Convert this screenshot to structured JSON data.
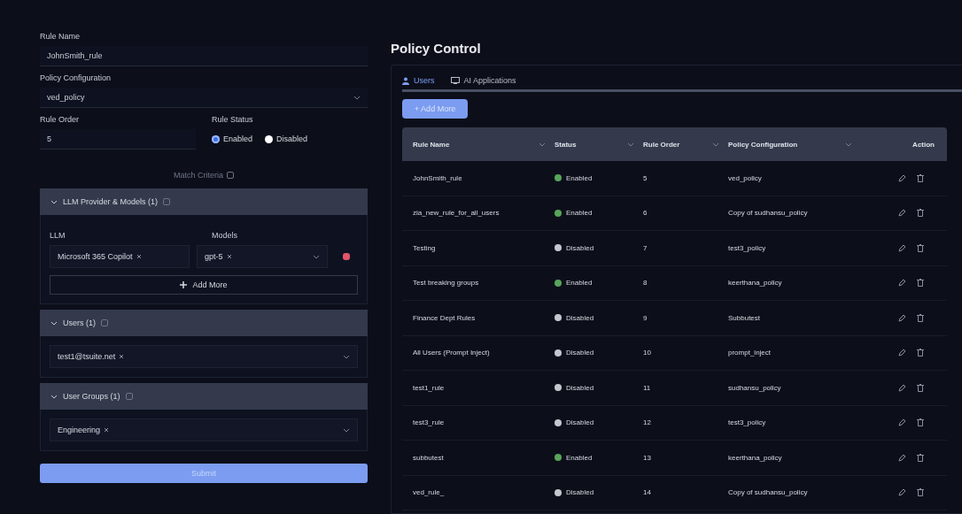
{
  "form": {
    "rule_name": {
      "label": "Rule Name",
      "value": "JohnSmith_rule"
    },
    "policy_configuration": {
      "label": "Policy Configuration",
      "value": "ved_policy"
    },
    "rule_order": {
      "label": "Rule Order",
      "value": "5"
    },
    "rule_status": {
      "label": "Rule Status",
      "options": [
        {
          "label": "Enabled",
          "selected": true
        },
        {
          "label": "Disabled",
          "selected": false
        }
      ]
    },
    "match_criteria": "Match Criteria",
    "sections": [
      {
        "kind": "llm",
        "title": "LLM Provider & Models (1)",
        "expanded": true,
        "llm_label": "LLM",
        "models_label": "Models",
        "llm_chip": "Microsoft 365 Copilot",
        "model_chip": "gpt-5",
        "add_more": "Add More"
      },
      {
        "kind": "select",
        "title": "Users (1)",
        "expanded": true,
        "chip": "test1@tsuite.net"
      },
      {
        "kind": "select",
        "title": "User Groups (1)",
        "expanded": true,
        "chip": "Engineering"
      }
    ],
    "submit": "Submit"
  },
  "policy": {
    "title": "Policy Control",
    "tabs": [
      {
        "label": "Users",
        "selected": true
      },
      {
        "label": "AI Applications",
        "selected": false
      }
    ],
    "add_button": "+ Add More",
    "table": {
      "columns": [
        "Rule Name",
        "Status",
        "Rule Order",
        "Policy Configuration",
        "Action"
      ],
      "rows": [
        {
          "name": "JohnSmith_rule",
          "status": "Enabled",
          "enabled": true,
          "order": "5",
          "policy": "ved_policy"
        },
        {
          "name": "zia_new_rule_for_all_users",
          "status": "Enabled",
          "enabled": true,
          "order": "6",
          "policy": "Copy of sudhansu_policy"
        },
        {
          "name": "Testing",
          "status": "Disabled",
          "enabled": false,
          "order": "7",
          "policy": "test3_policy"
        },
        {
          "name": "Test breaking groups",
          "status": "Enabled",
          "enabled": true,
          "order": "8",
          "policy": "keerthana_policy"
        },
        {
          "name": "Finance Dept Rules",
          "status": "Disabled",
          "enabled": false,
          "order": "9",
          "policy": "Subbutest"
        },
        {
          "name": "All Users (Prompt Inject)",
          "status": "Disabled",
          "enabled": false,
          "order": "10",
          "policy": "prompt_inject"
        },
        {
          "name": "test1_rule",
          "status": "Disabled",
          "enabled": false,
          "order": "11",
          "policy": "sudhansu_policy"
        },
        {
          "name": "test3_rule",
          "status": "Disabled",
          "enabled": false,
          "order": "12",
          "policy": "test3_policy"
        },
        {
          "name": "subbutest",
          "status": "Enabled",
          "enabled": true,
          "order": "13",
          "policy": "keerthana_policy"
        },
        {
          "name": "ved_rule_",
          "status": "Disabled",
          "enabled": false,
          "order": "14",
          "policy": "Copy of sudhansu_policy"
        }
      ]
    }
  }
}
